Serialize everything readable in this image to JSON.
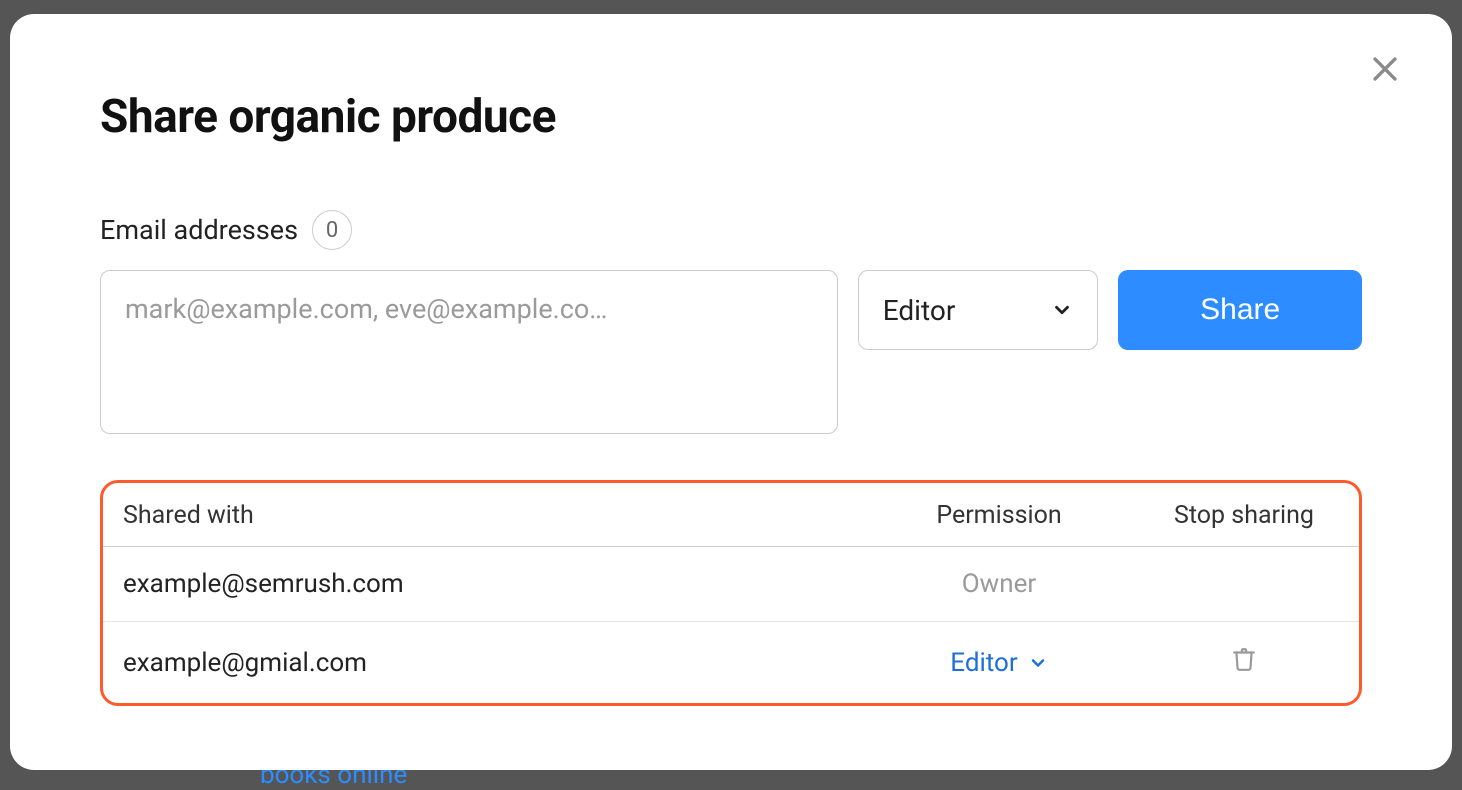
{
  "modal": {
    "title": "Share organic produce",
    "emailLabel": "Email addresses",
    "emailCount": "0",
    "emailPlaceholder": "mark@example.com, eve@example.co…",
    "roleSelected": "Editor",
    "shareButton": "Share"
  },
  "table": {
    "headers": {
      "sharedWith": "Shared with",
      "permission": "Permission",
      "stopSharing": "Stop sharing"
    },
    "rows": [
      {
        "email": "example@semrush.com",
        "permission": "Owner",
        "permissionType": "owner",
        "deletable": false
      },
      {
        "email": "example@gmial.com",
        "permission": "Editor",
        "permissionType": "dropdown",
        "deletable": true
      }
    ]
  },
  "background": {
    "hiddenText": "books online"
  }
}
